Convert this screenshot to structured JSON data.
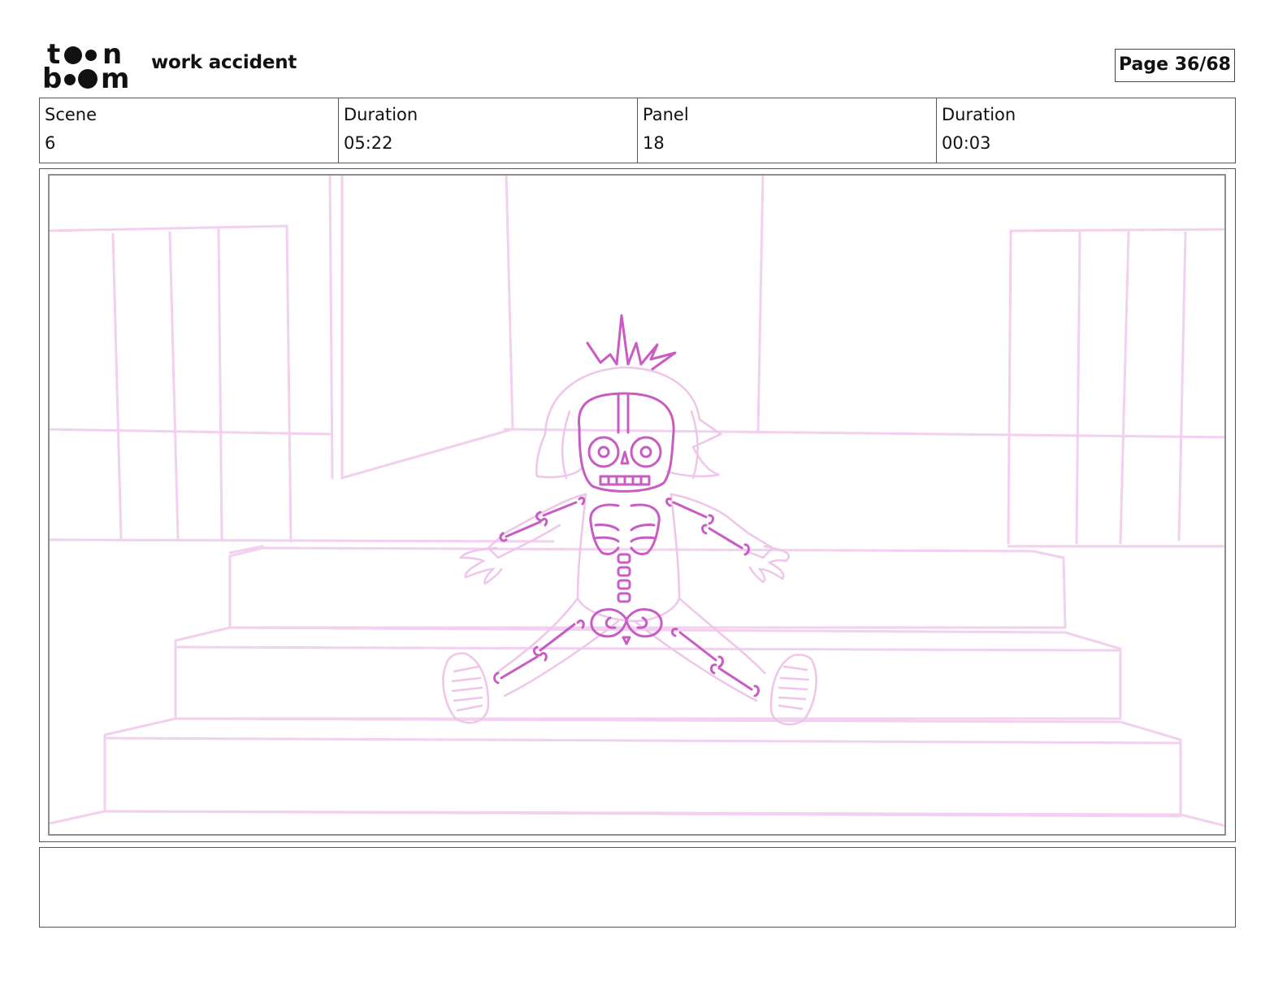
{
  "header": {
    "logo_text": "toon boom",
    "project_title": "work accident",
    "page_label": "Page 36/68"
  },
  "info": {
    "scene_label": "Scene",
    "scene_value": "6",
    "scene_duration_label": "Duration",
    "scene_duration_value": "05:22",
    "panel_label": "Panel",
    "panel_value": "18",
    "panel_duration_label": "Duration",
    "panel_duration_value": "00:03"
  },
  "panel": {
    "sketch_colors": {
      "background_lines": "#f2d0ef",
      "character_lines": "#c85cc2",
      "character_light": "#edc6ea"
    }
  },
  "notes": {
    "text": ""
  }
}
